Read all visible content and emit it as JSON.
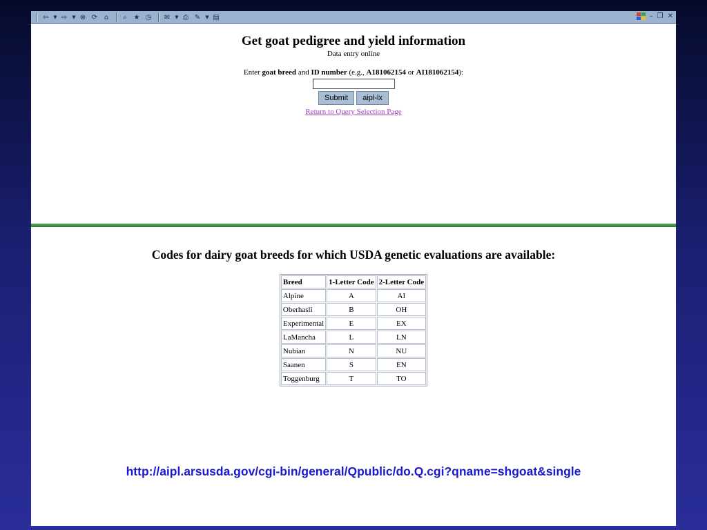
{
  "toolbar": {
    "icons": [
      "back-icon",
      "forward-icon",
      "stop-icon",
      "refresh-icon",
      "home-icon",
      "search-icon",
      "favorites-icon",
      "history-icon",
      "mail-icon",
      "print-icon",
      "edit-icon",
      "discuss-icon"
    ],
    "controls": {
      "minimize": "–",
      "restore": "❐",
      "close": "✕"
    }
  },
  "form": {
    "title": "Get goat pedigree and yield information",
    "subtitle": "Data entry online",
    "prompt_prefix": "Enter ",
    "prompt_breed": "goat breed",
    "prompt_and": " and ",
    "prompt_id": "ID number",
    "prompt_eg": " (e.g., ",
    "example1": "A181062154",
    "prompt_or": " or ",
    "example2": "AI181062154",
    "prompt_end": "):",
    "id_value": "",
    "submit_label": "Submit",
    "aipl_label": "aipl-lx",
    "return_link": "Return to Query Selection Page"
  },
  "codes": {
    "title": "Codes for dairy goat breeds for which USDA genetic evaluations are available:",
    "headers": [
      "Breed",
      "1-Letter Code",
      "2-Letter Code"
    ],
    "rows": [
      [
        "Alpine",
        "A",
        "AI"
      ],
      [
        "Oberhasli",
        "B",
        "OH"
      ],
      [
        "Experimental",
        "E",
        "EX"
      ],
      [
        "LaMancha",
        "L",
        "LN"
      ],
      [
        "Nubian",
        "N",
        "NU"
      ],
      [
        "Saanen",
        "S",
        "EN"
      ],
      [
        "Toggenburg",
        "T",
        "TO"
      ]
    ]
  },
  "url": "http://aipl.arsusda.gov/cgi-bin/general/Qpublic/do.Q.cgi?qname=shgoat&single",
  "colors": {
    "toolbar": "#9bb3cf",
    "divider": "#3a8a3a",
    "link_visited": "#a040c0",
    "url_text": "#1a1acc"
  }
}
